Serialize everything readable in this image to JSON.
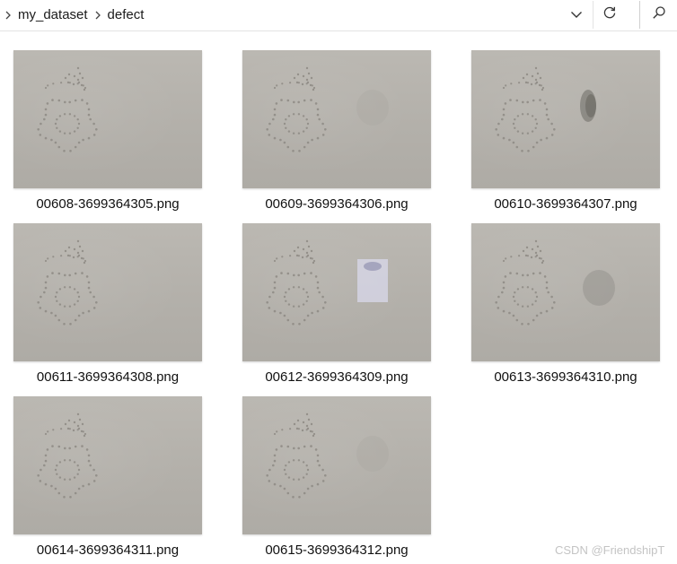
{
  "breadcrumb": {
    "items": [
      "my_dataset",
      "defect"
    ]
  },
  "toolbar": {
    "dropdown_icon": "chevron-down-icon",
    "refresh_icon": "refresh-icon",
    "search_icon": "search-icon"
  },
  "files": [
    {
      "name": "00608-3699364305.png",
      "defect": "none"
    },
    {
      "name": "00609-3699364306.png",
      "defect": "faint"
    },
    {
      "name": "00610-3699364307.png",
      "defect": "dark-blot"
    },
    {
      "name": "00611-3699364308.png",
      "defect": "none"
    },
    {
      "name": "00612-3699364309.png",
      "defect": "bright-glare"
    },
    {
      "name": "00613-3699364310.png",
      "defect": "grey-smudge"
    },
    {
      "name": "00614-3699364311.png",
      "defect": "none"
    },
    {
      "name": "00615-3699364312.png",
      "defect": "faint"
    }
  ],
  "watermark": "CSDN @FriendshipT",
  "colors": {
    "fabric": "#b6b3ad",
    "stitch": "#8d8a84",
    "text": "#111111"
  }
}
